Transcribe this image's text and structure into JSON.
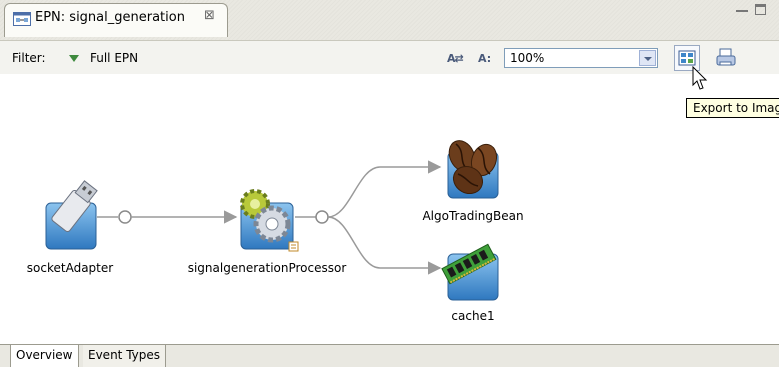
{
  "editor_tab": {
    "title": "EPN: signal_generation",
    "close_glyph": "⊠"
  },
  "toolbar": {
    "filter_label": "Filter:",
    "filter_value": "Full EPN",
    "zoom_value": "100%",
    "layout_icon": "A⇄",
    "zoom_icon": "A:",
    "export_tooltip": "Export to Imag"
  },
  "nodes": {
    "socket_adapter": "socketAdapter",
    "processor": "signalgenerationProcessor",
    "bean": "AlgoTradingBean",
    "cache": "cache1"
  },
  "bottom_tabs": {
    "overview": "Overview",
    "event_types": "Event Types"
  },
  "icons": [
    "epn-editor-icon",
    "close-icon",
    "minimize-icon",
    "maximize-icon",
    "filter-arrow-icon",
    "auto-layout-icon",
    "zoom-icon",
    "export-image-icon",
    "print-icon",
    "mouse-cursor-icon",
    "adapter-usb-icon",
    "gear-processor-icon",
    "coffee-bean-icon",
    "memory-chip-icon"
  ],
  "colors": {
    "accent_green": "#3e8a3e",
    "tab_strip": "#e9e8e1",
    "tooltip_bg": "#ffffe1",
    "icon_blue": "#3e86c9"
  }
}
